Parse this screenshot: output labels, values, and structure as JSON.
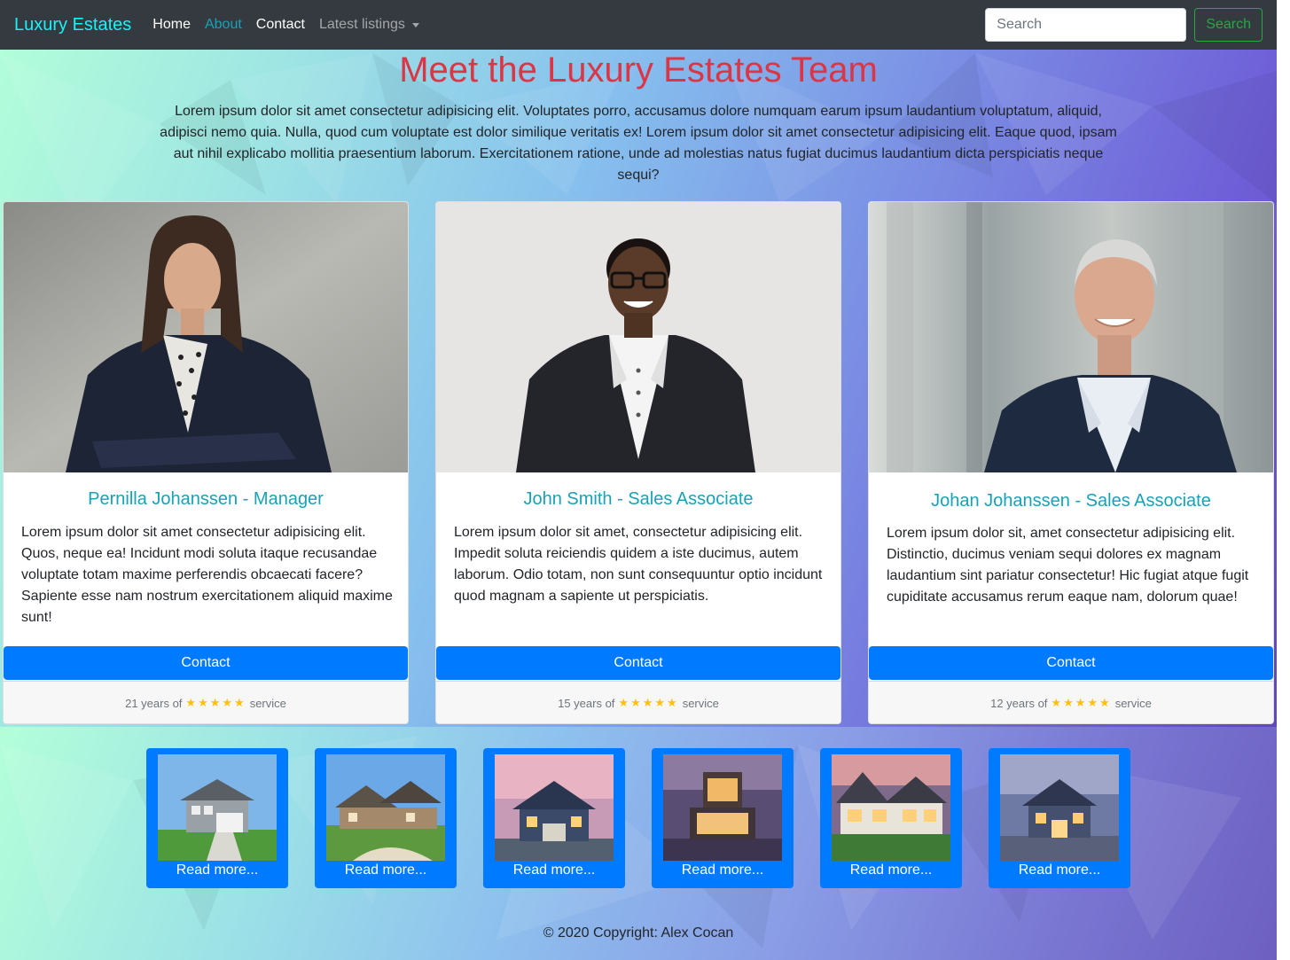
{
  "nav": {
    "brand": "Luxury Estates",
    "home": "Home",
    "about": "About",
    "contact": "Contact",
    "latest": "Latest listings",
    "search_placeholder": "Search",
    "search_button": "Search"
  },
  "hero": {
    "title": "Meet the Luxury Estates Team",
    "intro": "Lorem ipsum dolor sit amet consectetur adipisicing elit. Voluptates porro, accusamus dolore numquam earum ipsum laudantium voluptatum, aliquid, adipisci nemo quia. Nulla, quod cum voluptate est dolor similique veritatis ex! Lorem ipsum dolor sit amet consectetur adipisicing elit. Eaque quod, ipsam aut nihil explicabo mollitia praesentium laborum. Exercitationem ratione, unde ad molestias natus fugiat ducimus laudantium dicta perspiciatis neque sequi?"
  },
  "team": [
    {
      "name": "Pernilla Johanssen - Manager",
      "text": "Lorem ipsum dolor sit amet consectetur adipisicing elit. Quos, neque ea! Incidunt modi soluta itaque recusandae voluptate totam maxime perferendis obcaecati facere? Sapiente esse nam nostrum exercitationem aliquid maxime sunt!",
      "button": "Contact",
      "years": "21 years of",
      "stars": "★★★★★",
      "service": "service"
    },
    {
      "name": "John Smith - Sales Associate",
      "text": "Lorem ipsum dolor sit amet, consectetur adipisicing elit. Impedit soluta reiciendis quidem a iste ducimus, autem laborum. Odio totam, non sunt consequuntur optio incidunt quod magnam a sapiente ut perspiciatis.",
      "button": "Contact",
      "years": "15 years of",
      "stars": "★★★★★",
      "service": "service"
    },
    {
      "name": "Johan Johanssen - Sales Associate",
      "text": "Lorem ipsum dolor sit, amet consectetur adipisicing elit. Distinctio, ducimus veniam sequi dolores ex magnam laudantium sint pariatur consectetur! Hic fugiat atque fugit cupiditate accusamus rerum eaque nam, dolorum quae!",
      "button": "Contact",
      "years": "12 years of",
      "stars": "★★★★★",
      "service": "service"
    }
  ],
  "listings": [
    {
      "label": "Read more..."
    },
    {
      "label": "Read more..."
    },
    {
      "label": "Read more..."
    },
    {
      "label": "Read more..."
    },
    {
      "label": "Read more..."
    },
    {
      "label": "Read more..."
    }
  ],
  "footer": "© 2020 Copyright: Alex Cocan",
  "colors": {
    "brand": "#17f3f6",
    "title": "#dc3545",
    "accent": "#007bff",
    "name": "#17a2b8",
    "star": "#ffc107",
    "search_button": "#28a745"
  }
}
